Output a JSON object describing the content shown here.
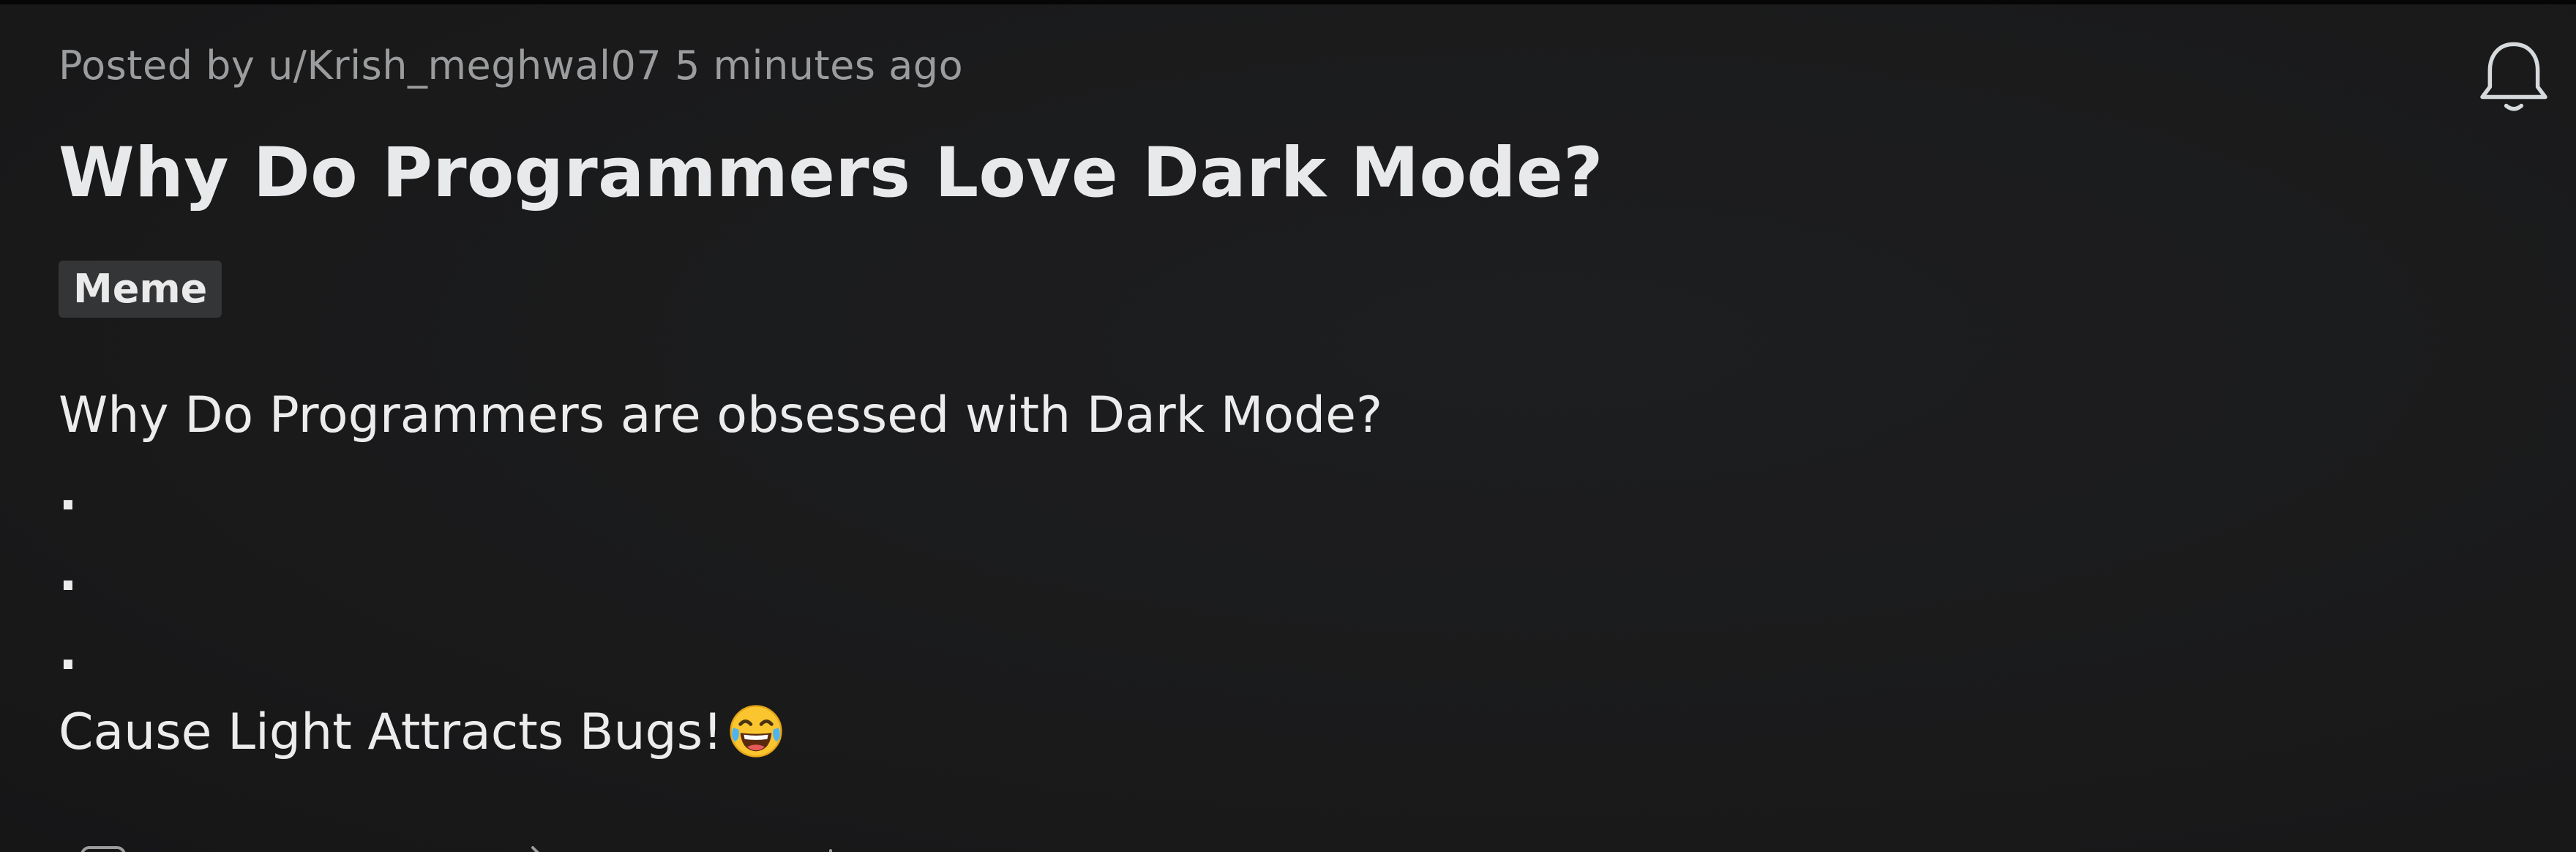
{
  "post": {
    "meta_prefix": "Posted by",
    "author": "u/Krish_meghwal07",
    "time_ago": "5 minutes ago",
    "title": "Why Do Programmers Love Dark Mode?",
    "flair": "Meme",
    "body_lines": [
      "Why Do Programmers are obsessed with Dark Mode?",
      ".",
      ".",
      ".",
      "Cause Light Attracts Bugs!"
    ],
    "emoji": "face-with-tears-of-joy"
  },
  "icons": {
    "notification": "bell-icon",
    "actions": [
      "comment-icon",
      "share-icon",
      "save-icon"
    ]
  },
  "colors": {
    "background": "#1a1a1b",
    "meta_text": "#9a9c9e",
    "title_text": "#e8e9ea",
    "flair_bg": "#343536"
  }
}
